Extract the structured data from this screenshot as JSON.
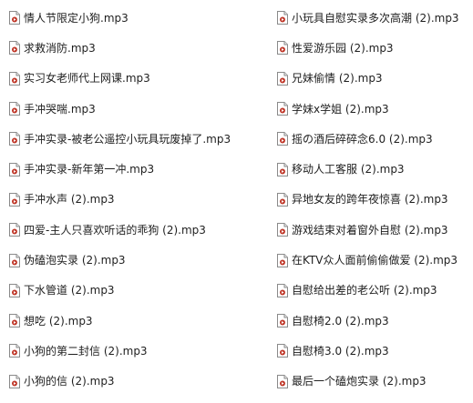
{
  "files_left": [
    {
      "name": "情人节限定小狗.mp3"
    },
    {
      "name": "求救消防.mp3"
    },
    {
      "name": "实习女老师代上网课.mp3"
    },
    {
      "name": "手冲哭喘.mp3"
    },
    {
      "name": "手冲实录-被老公遥控小玩具玩废掉了.mp3"
    },
    {
      "name": "手冲实录-新年第一冲.mp3"
    },
    {
      "name": "手冲水声 (2).mp3"
    },
    {
      "name": "四爱-主人只喜欢听话的乖狗 (2).mp3"
    },
    {
      "name": "伪磕泡实录 (2).mp3"
    },
    {
      "name": "下水管道 (2).mp3"
    },
    {
      "name": "想吃 (2).mp3"
    },
    {
      "name": "小狗的第二封信 (2).mp3"
    },
    {
      "name": "小狗的信 (2).mp3"
    }
  ],
  "files_right": [
    {
      "name": "小玩具自慰实录多次高潮 (2).mp3"
    },
    {
      "name": "性爱游乐园 (2).mp3"
    },
    {
      "name": "兄妹偷情 (2).mp3"
    },
    {
      "name": "学妹x学姐 (2).mp3"
    },
    {
      "name": "摇の酒后碎碎念6.0 (2).mp3"
    },
    {
      "name": "移动人工客服 (2).mp3"
    },
    {
      "name": "异地女友的跨年夜惊喜 (2).mp3"
    },
    {
      "name": "游戏结束对着窗外自慰 (2).mp3"
    },
    {
      "name": "在KTV众人面前偷偷做爱 (2).mp3"
    },
    {
      "name": "自慰给出差的老公听 (2).mp3"
    },
    {
      "name": "自慰椅2.0 (2).mp3"
    },
    {
      "name": "自慰椅3.0 (2).mp3"
    },
    {
      "name": "最后一个磕炮实录 (2).mp3"
    }
  ],
  "icon": {
    "name": "audio-file-icon",
    "accent": "#c0392b"
  }
}
